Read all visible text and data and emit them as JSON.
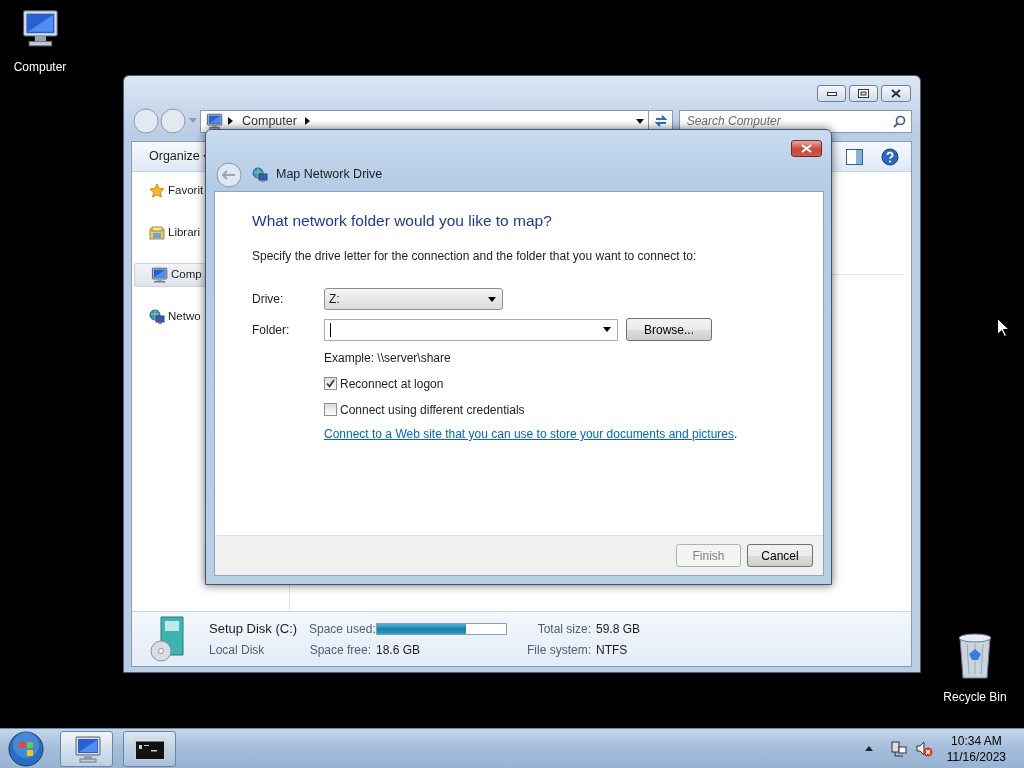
{
  "desktop_icons": [
    {
      "label": "Computer",
      "kind": "computer"
    },
    {
      "label": "Recycle Bin",
      "kind": "recycle"
    }
  ],
  "explorer": {
    "address": {
      "crumb": "Computer"
    },
    "search": {
      "placeholder": "Search Computer"
    },
    "organize": "Organize",
    "sidebar": [
      {
        "label": "Favorit",
        "kind": "star",
        "selected": false
      },
      {
        "label": "Librari",
        "kind": "library",
        "selected": false
      },
      {
        "label": "Comp",
        "kind": "computer",
        "selected": true
      },
      {
        "label": "Netwo",
        "kind": "network",
        "selected": false
      }
    ],
    "details": {
      "name": "Setup Disk (C:)",
      "type": "Local Disk",
      "used_label": "Space used:",
      "level": 0.69,
      "free_label": "Space free:",
      "free": "18.6 GB",
      "total_label": "Total size:",
      "total": "59.8 GB",
      "fs_label": "File system:",
      "fs": "NTFS"
    }
  },
  "dialog": {
    "title": "Map Network Drive",
    "heading": "What network folder would you like to map?",
    "instruction": "Specify the drive letter for the connection and the folder that you want to connect to:",
    "drive": {
      "label": "Drive:",
      "value": "Z:"
    },
    "folder": {
      "label": "Folder:",
      "browse": "Browse..."
    },
    "example": "Example: \\\\server\\share",
    "checkboxes": [
      {
        "label": "Reconnect at logon",
        "checked": true
      },
      {
        "label": "Connect using different credentials",
        "checked": false
      }
    ],
    "link": "Connect to a Web site that you can use to store your documents and pictures",
    "link_tail": ".",
    "buttons": [
      {
        "label": "Finish",
        "disabled": true
      },
      {
        "label": "Cancel",
        "disabled": false
      }
    ]
  },
  "taskbar": {
    "buttons": [
      {
        "kind": "explorer",
        "selected": true
      },
      {
        "kind": "console",
        "selected": false
      }
    ],
    "time": "10:34 AM",
    "date": "11/16/2023"
  }
}
